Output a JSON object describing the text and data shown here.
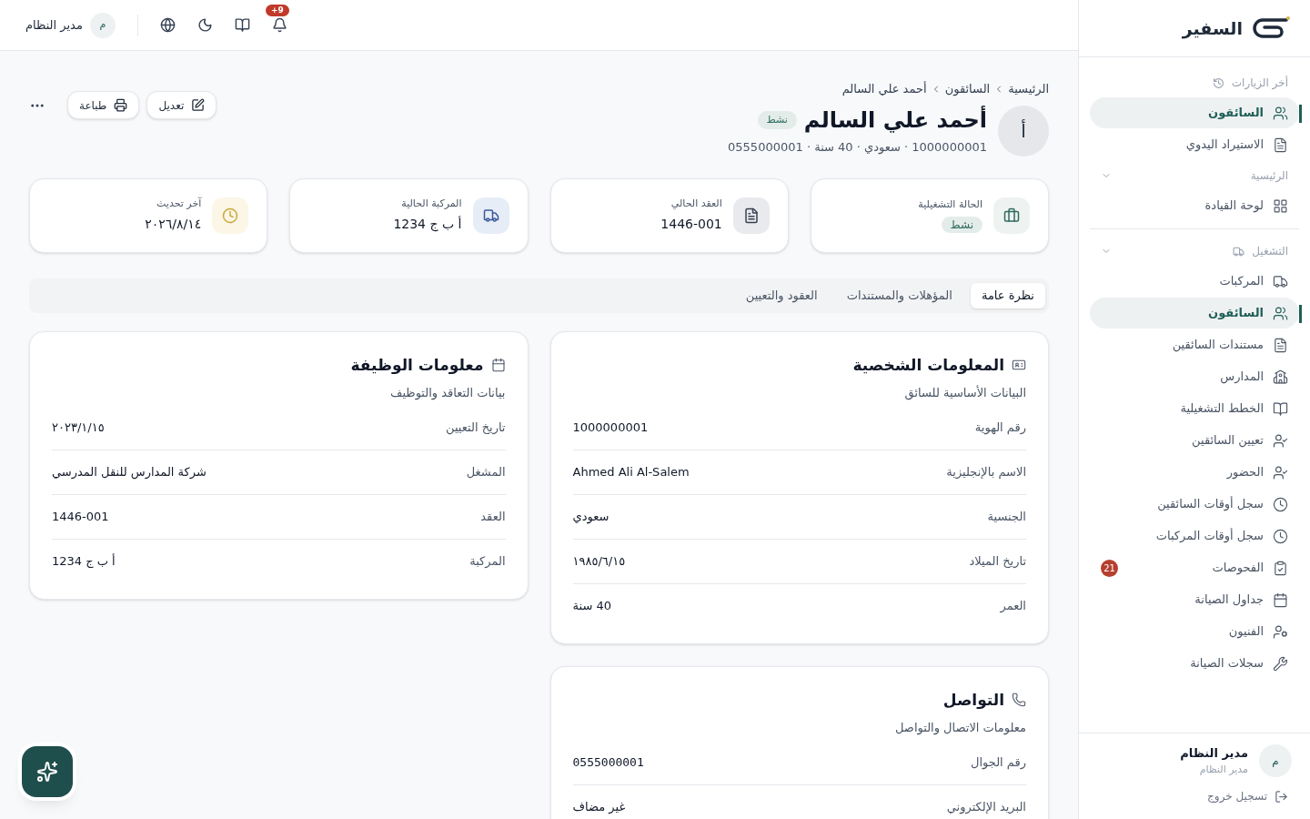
{
  "sidebar": {
    "logo": "السفير",
    "sections": [
      {
        "title": "أخر الزيارات",
        "kind": "recent",
        "items": [
          {
            "label": "السائقون",
            "selected": true
          },
          {
            "label": "الاستيراد اليدوي",
            "selected": false
          }
        ]
      },
      {
        "title": "الرئيسية",
        "kind": "group",
        "expanded": true,
        "items": [
          {
            "label": "لوحة القيادة",
            "selected": false
          }
        ]
      },
      {
        "title": "التشغيل",
        "kind": "group-truck",
        "expanded": true,
        "items": [
          {
            "label": "المركبات",
            "selected": false
          },
          {
            "label": "السائقون",
            "selected": true
          },
          {
            "label": "مستندات السائقين",
            "selected": false
          },
          {
            "label": "المدارس",
            "selected": false
          },
          {
            "label": "الخطط التشغيلية",
            "selected": false
          },
          {
            "label": "تعيين السائقين",
            "selected": false
          },
          {
            "label": "الحضور",
            "selected": false
          },
          {
            "label": "سجل أوقات السائقين",
            "selected": false
          },
          {
            "label": "سجل أوقات المركبات",
            "selected": false
          },
          {
            "label": "الفحوصات",
            "selected": false,
            "badge": "21"
          },
          {
            "label": "جداول الصيانة",
            "selected": false
          },
          {
            "label": "الفنيون",
            "selected": false
          },
          {
            "label": "سجلات الصيانة",
            "selected": false
          }
        ]
      }
    ],
    "user": {
      "avatar": "م",
      "name": "مدير النظام",
      "role": "مدير النظام"
    },
    "logout": "تسجيل خروج"
  },
  "topbar": {
    "notifications": "+9",
    "avatar": "م",
    "user": "مدير النظام"
  },
  "breadcrumb": [
    "الرئيسية",
    "السائقون",
    "أحمد علي السالم"
  ],
  "profile": {
    "avatar": "أ",
    "name": "أحمد علي السالم",
    "status": "نشط",
    "meta": "1000000001 · سعودي · 40 سنة · 0555000001"
  },
  "actions": [
    "تعديل",
    "طباعة"
  ],
  "stats": [
    {
      "label": "الحالة التشغيلية",
      "value": "نشط",
      "kind": "badge",
      "color": "#2f6b5e"
    },
    {
      "label": "العقد الحالي",
      "value": "1446-001",
      "kind": "text",
      "color": "#374151"
    },
    {
      "label": "المركبة الحالية",
      "value": "أ ب ج 1234",
      "kind": "text",
      "color": "#3b5b9a"
    },
    {
      "label": "آخر تحديث",
      "value": "٢٠٢٦/٨/١٤",
      "kind": "text",
      "color": "#c9a93b"
    }
  ],
  "tabs": [
    {
      "label": "نظرة عامة",
      "selected": true
    },
    {
      "label": "المؤهلات والمستندات",
      "selected": false
    },
    {
      "label": "العقود والتعيين",
      "selected": false
    }
  ],
  "cards": [
    {
      "title": "المعلومات الشخصية",
      "subtitle": "البيانات الأساسية للسائق",
      "kind": "id",
      "rows": [
        {
          "label": "رقم الهوية",
          "value": "1000000001"
        },
        {
          "label": "الاسم بالإنجليزية",
          "value": "Ahmed Ali Al-Salem"
        },
        {
          "label": "الجنسية",
          "value": "سعودي"
        },
        {
          "label": "تاريخ الميلاد",
          "value": "١٩٨٥/٦/١٥"
        },
        {
          "label": "العمر",
          "value": "40 سنة"
        }
      ]
    },
    {
      "title": "معلومات الوظيفة",
      "subtitle": "بيانات التعاقد والتوظيف",
      "kind": "calendar",
      "rows": [
        {
          "label": "تاريخ التعيين",
          "value": "٢٠٢٣/١/١٥"
        },
        {
          "label": "المشغل",
          "value": "شركة المدارس للنقل المدرسي"
        },
        {
          "label": "العقد",
          "value": "1446-001"
        },
        {
          "label": "المركبة",
          "value": "أ ب ج 1234"
        }
      ]
    },
    {
      "title": "التواصل",
      "subtitle": "معلومات الاتصال والتواصل",
      "kind": "phone",
      "rows": [
        {
          "label": "رقم الجوال",
          "value": "0555000001",
          "mono": true
        },
        {
          "label": "البريد الإلكتروني",
          "value": "غير مضاف"
        }
      ]
    }
  ]
}
